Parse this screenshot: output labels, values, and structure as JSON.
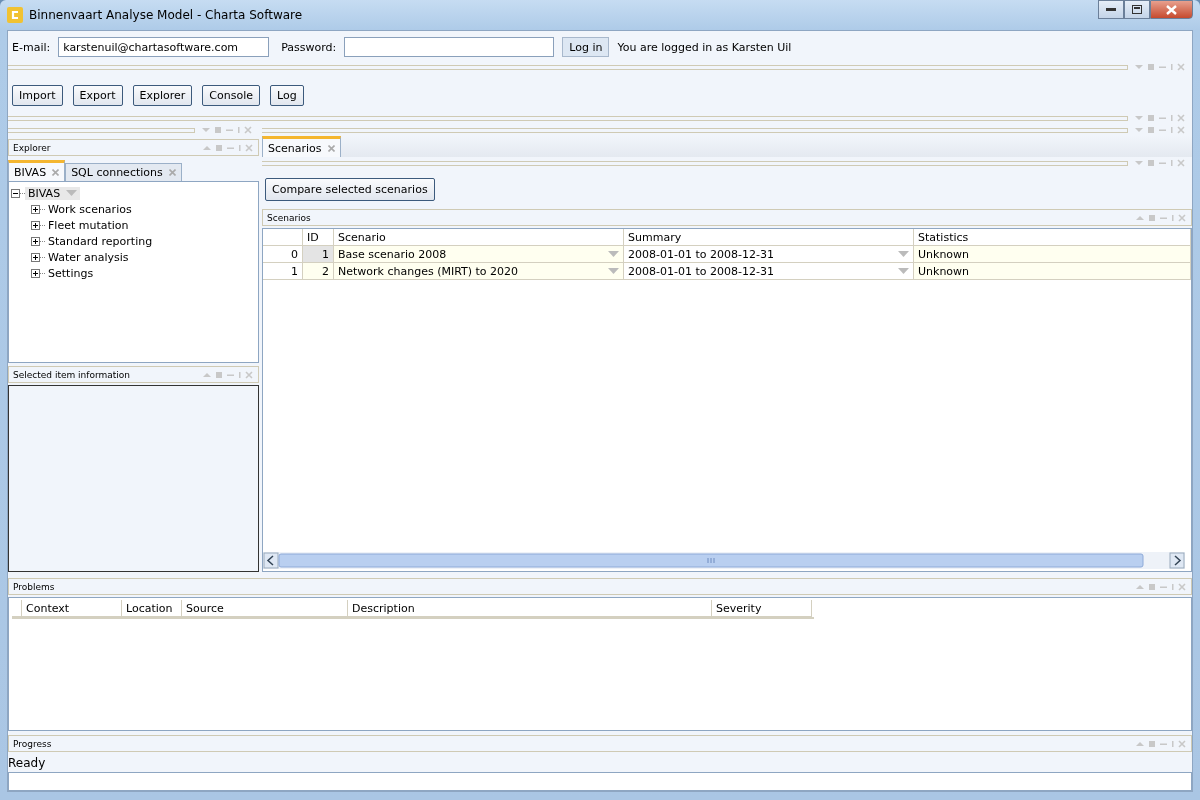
{
  "window": {
    "title": "Binnenvaart Analyse Model - Charta Software"
  },
  "login": {
    "email_label": "E-mail:",
    "email_value": "karstenuil@chartasoftware.com",
    "password_label": "Password:",
    "button": "Log in",
    "status": "You are logged in as Karsten Uil"
  },
  "toolbar": [
    "Import",
    "Export",
    "Explorer",
    "Console",
    "Log"
  ],
  "explorer": {
    "title": "Explorer",
    "tabs": [
      {
        "label": "BIVAS",
        "selected": true
      },
      {
        "label": "SQL connections",
        "selected": false
      }
    ],
    "tree": [
      {
        "label": "BIVAS",
        "expanded": true,
        "selected": true,
        "children": [
          {
            "label": "Work scenarios",
            "expanded": false,
            "selected": false
          },
          {
            "label": "Fleet mutation",
            "expanded": false,
            "selected": false
          },
          {
            "label": "Standard reporting",
            "expanded": false,
            "selected": false
          },
          {
            "label": "Water analysis",
            "expanded": false,
            "selected": false
          },
          {
            "label": "Settings",
            "expanded": false,
            "selected": false
          }
        ]
      }
    ]
  },
  "selected_item_information": {
    "title": "Selected item information"
  },
  "document_tabs": [
    {
      "label": "Scenarios",
      "selected": true
    }
  ],
  "compare_button": "Compare selected scenarios",
  "scenarios": {
    "title": "Scenarios",
    "columns": [
      "ID",
      "Scenario",
      "Summary",
      "Statistics"
    ],
    "rows": [
      {
        "index": "0",
        "id": "1",
        "scenario": "Base scenario 2008",
        "summary": "2008-01-01 to 2008-12-31",
        "statistics": "Unknown",
        "selected": true
      },
      {
        "index": "1",
        "id": "2",
        "scenario": "Network changes (MIRT) to 2020",
        "summary": "2008-01-01 to 2008-12-31",
        "statistics": "Unknown",
        "selected": false
      }
    ]
  },
  "problems": {
    "title": "Problems",
    "columns": [
      "Context",
      "Location",
      "Source",
      "Description",
      "Severity"
    ]
  },
  "progress": {
    "title": "Progress",
    "status": "Ready",
    "level": 0
  }
}
